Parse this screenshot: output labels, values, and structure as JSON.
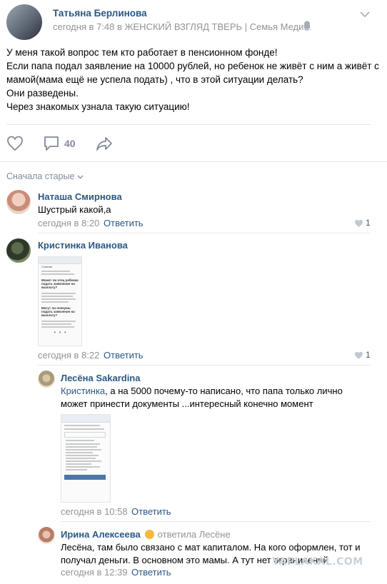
{
  "post": {
    "author": "Татьяна Берлинова",
    "meta": "сегодня в 7:48 в ЖЕНСКИЙ ВЗГЛЯД ТВЕРЬ | Семья Меди...",
    "lines": [
      "У меня такой вопрос тем кто работает в пенсионном фонде!",
      "Если папа подал заявление на 10000 рублей, но ребенок не живёт с ним а живёт с",
      "мамой(мама ещё не успела подать) , что в этой ситуации делать?",
      "Они разведены.",
      "Через знакомых узнала такую ситуацию!"
    ],
    "comments_count": "40"
  },
  "sort_label": "Сначала старые",
  "comments": [
    {
      "author": "Наташа Смирнова",
      "text": "Шустрый какой,а",
      "time": "сегодня в 8:20",
      "reply": "Ответить",
      "likes": "1"
    },
    {
      "author": "Кристинка Иванова",
      "time": "сегодня в 8:22",
      "reply": "Ответить",
      "likes": "1",
      "shot": {
        "title": "Главная",
        "h1": "Может ли отец ребенка подать заявление на выплату?",
        "h2": "Могут ли опекуны подать заявление на выплату?"
      }
    },
    {
      "author": "Лесёна Sakardina",
      "mention": "Кристинка",
      "text1": ", а на 5000 почему-то написано, что папа только лично",
      "text2": "может принести документы ...интересный конечно момент",
      "time": "сегодня в 10:58",
      "reply": "Ответить"
    },
    {
      "author": "Ирина Алексеева",
      "answered": "ответила Лесёне",
      "text1": "Лесёна, там было связано с мат капиталом. На кого оформлен, тот и",
      "text2": "получал деньги. В основном это мамы. А тут нет ограничений",
      "time": "сегодня в 12:39",
      "reply": "Ответить"
    }
  ],
  "watermark": "YAPLAKAL.COM"
}
